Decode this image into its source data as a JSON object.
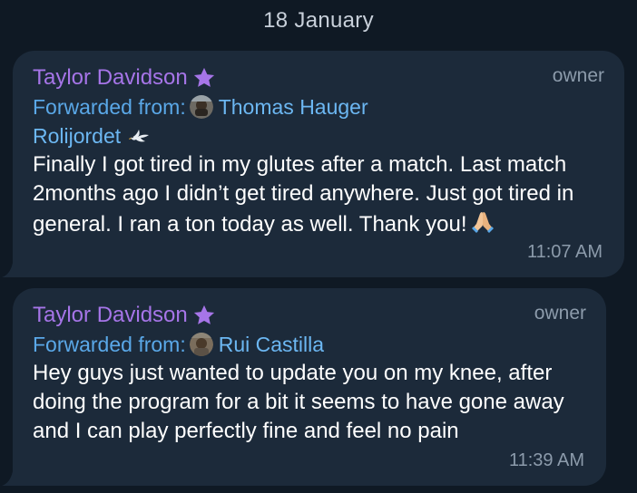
{
  "date_label": "18 January",
  "messages": [
    {
      "sender": "Taylor Davidson",
      "role": "owner",
      "forwarded_label": "Forwarded from:",
      "forwarded_name_line1": "Thomas Hauger",
      "forwarded_name_line2": "Rolijordet",
      "text": "Finally I got tired in my glutes after a match. Last match 2months ago I didn’t get tired anywhere. Just got tired in general. I ran a ton today as well. Thank you!",
      "emoji": "folded-hands",
      "time": "11:07 AM"
    },
    {
      "sender": "Taylor Davidson",
      "role": "owner",
      "forwarded_label": "Forwarded from:",
      "forwarded_name_line1": "Rui Castilla",
      "text": "Hey guys just wanted to update you on my knee, after doing the program for a bit it seems to have gone away and I can play perfectly fine and feel no pain",
      "time": "11:39 AM"
    }
  ],
  "colors": {
    "background": "#0f1924",
    "bubble": "#1c2a3a",
    "sender": "#a675e8",
    "forwarded_label": "#5aa8e8",
    "forwarded_name": "#6cb7f2",
    "meta": "#8c9bab"
  },
  "icons": {
    "premium_star": "star-icon",
    "dove": "dove-emoji",
    "praying_hands": "folded-hands-emoji"
  }
}
